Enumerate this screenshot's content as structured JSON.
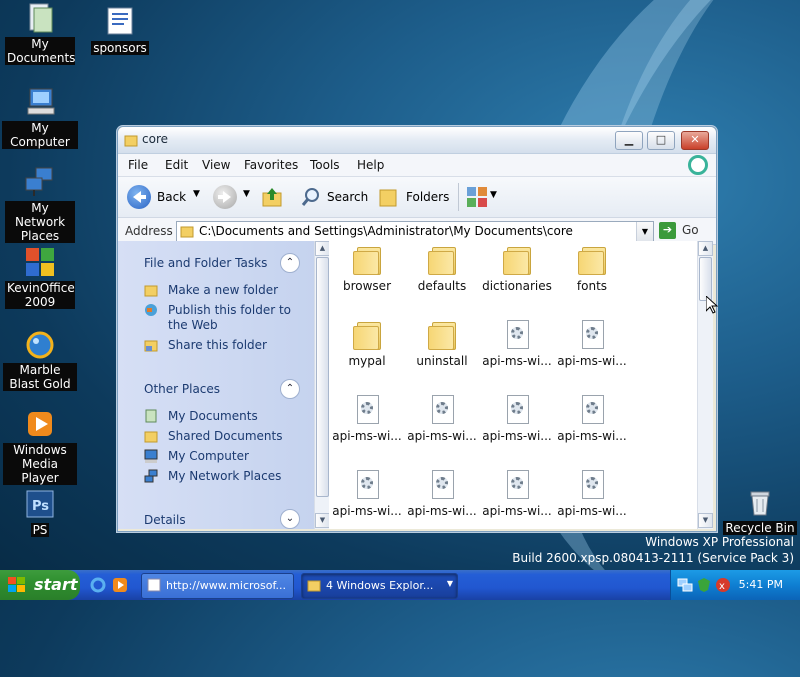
{
  "desktop": {
    "icons": [
      {
        "label": "My Documents",
        "icon": "my-documents-icon"
      },
      {
        "label": "sponsors",
        "icon": "document-icon"
      },
      {
        "label": "My Computer",
        "icon": "my-computer-icon"
      },
      {
        "label": "My Network Places",
        "icon": "network-places-icon"
      },
      {
        "label": "KevinOffice 2009",
        "icon": "office-icon"
      },
      {
        "label": "Marble Blast Gold",
        "icon": "marble-blast-icon"
      },
      {
        "label": "Windows Media Player",
        "icon": "media-player-icon"
      },
      {
        "label": "PS",
        "icon": "photoshop-icon"
      },
      {
        "label": "Recycle Bin",
        "icon": "recycle-bin-icon"
      }
    ],
    "branding": {
      "line1": "Windows XP Professional",
      "line2": "Build 2600.xpsp.080413-2111 (Service Pack 3)"
    }
  },
  "window": {
    "title": "core",
    "menu": [
      "File",
      "Edit",
      "View",
      "Favorites",
      "Tools",
      "Help"
    ],
    "toolbar": {
      "back": "Back",
      "search": "Search",
      "folders": "Folders"
    },
    "address": {
      "label": "Address",
      "path": "C:\\Documents and Settings\\Administrator\\My Documents\\core",
      "go": "Go"
    },
    "tasks_pane": {
      "file_tasks_title": "File and Folder Tasks",
      "file_tasks": [
        "Make a new folder",
        "Publish this folder to the Web",
        "Share this folder"
      ],
      "other_places_title": "Other Places",
      "other_places": [
        "My Documents",
        "Shared Documents",
        "My Computer",
        "My Network Places"
      ],
      "details_title": "Details"
    },
    "files": [
      {
        "name": "browser",
        "type": "folder"
      },
      {
        "name": "defaults",
        "type": "folder"
      },
      {
        "name": "dictionaries",
        "type": "folder"
      },
      {
        "name": "fonts",
        "type": "folder"
      },
      {
        "name": "mypal",
        "type": "folder"
      },
      {
        "name": "uninstall",
        "type": "folder"
      },
      {
        "name": "api-ms-wi...",
        "type": "dll"
      },
      {
        "name": "api-ms-wi...",
        "type": "dll"
      },
      {
        "name": "api-ms-wi...",
        "type": "dll"
      },
      {
        "name": "api-ms-wi...",
        "type": "dll"
      },
      {
        "name": "api-ms-wi...",
        "type": "dll"
      },
      {
        "name": "api-ms-wi...",
        "type": "dll"
      },
      {
        "name": "api-ms-wi...",
        "type": "dll"
      },
      {
        "name": "api-ms-wi...",
        "type": "dll"
      },
      {
        "name": "api-ms-wi...",
        "type": "dll"
      },
      {
        "name": "api-ms-wi...",
        "type": "dll"
      }
    ]
  },
  "taskbar": {
    "start": "start",
    "buttons": [
      {
        "label": "http://www.microsof...",
        "active": false
      },
      {
        "label": "4 Windows Explor...",
        "active": true
      }
    ],
    "clock": "5:41 PM"
  },
  "colors": {
    "taskbar": "#245ed6",
    "start": "#2f8f2f",
    "tray": "#0f7fd2",
    "taskpane": "#c4d2ee"
  }
}
